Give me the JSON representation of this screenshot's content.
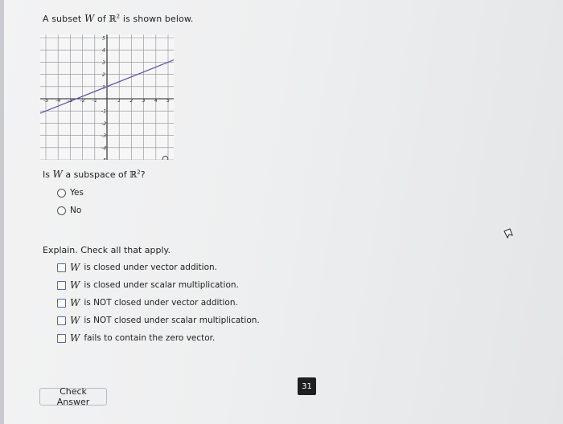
{
  "question": {
    "title_prefix": "A subset",
    "title_var": "W",
    "title_mid": "of",
    "title_space": "ℝ",
    "title_exp": "2",
    "title_suffix": "is shown below."
  },
  "graph": {
    "x_ticks": [
      "-5",
      "-4",
      "-3",
      "-2",
      "-1",
      "1",
      "2",
      "3",
      "4",
      "5"
    ],
    "y_ticks": [
      "5",
      "4",
      "3",
      "2",
      "1",
      "-1",
      "-2",
      "-3",
      "-4",
      "-5"
    ],
    "line": {
      "slope": 0.4,
      "intercept": 1,
      "color": "#5b4fa8"
    },
    "zoom_icon": "magnify-icon"
  },
  "subspace_question": {
    "prefix": "Is",
    "var": "W",
    "mid": "a subspace of",
    "space": "ℝ",
    "exp": "2",
    "suffix": "?"
  },
  "options": [
    "Yes",
    "No"
  ],
  "explain": {
    "prompt": "Explain. Check all that apply.",
    "items": [
      {
        "var": "W",
        "text": "is closed under vector addition."
      },
      {
        "var": "W",
        "text": "is closed under scalar multiplication."
      },
      {
        "var": "W",
        "text": "is NOT closed under vector addition."
      },
      {
        "var": "W",
        "text": "is NOT closed under scalar multiplication."
      },
      {
        "var": "W",
        "text": "fails to contain the zero vector."
      }
    ]
  },
  "check_button": "Check Answer",
  "page_number": "31",
  "colors": {
    "checkbox_border": "#4a6fa5",
    "line": "#5b4fa8",
    "badge": "#1d1f21"
  }
}
